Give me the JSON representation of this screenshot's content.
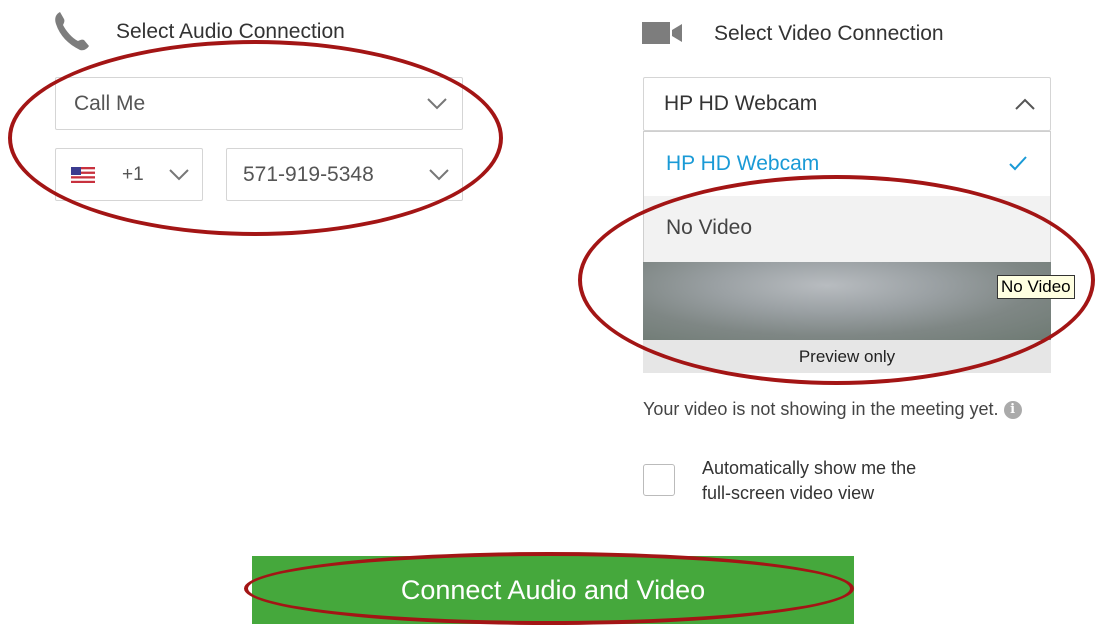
{
  "audio": {
    "title": "Select Audio Connection",
    "icon": "phone-icon",
    "connection_value": "Call Me",
    "country_code": "+1",
    "country_flag": "us-flag-icon",
    "phone_number": "571-919-5348"
  },
  "video": {
    "title": "Select Video Connection",
    "icon": "video-camera-icon",
    "selected_value": "HP HD Webcam",
    "options": [
      {
        "label": "HP HD Webcam",
        "selected": true
      },
      {
        "label": "No Video",
        "selected": false
      }
    ],
    "tooltip": "No Video",
    "preview_label": "Preview only",
    "note": "Your video is not showing in the meeting yet.",
    "auto_fullscreen_label_line1": "Automatically show me the",
    "auto_fullscreen_label_line2": "full-screen video view"
  },
  "connect_button": {
    "label": "Connect Audio and Video"
  },
  "colors": {
    "accent_green": "#45a83c",
    "selected_blue": "#1a9ad6",
    "annotation_red": "#a31515"
  }
}
